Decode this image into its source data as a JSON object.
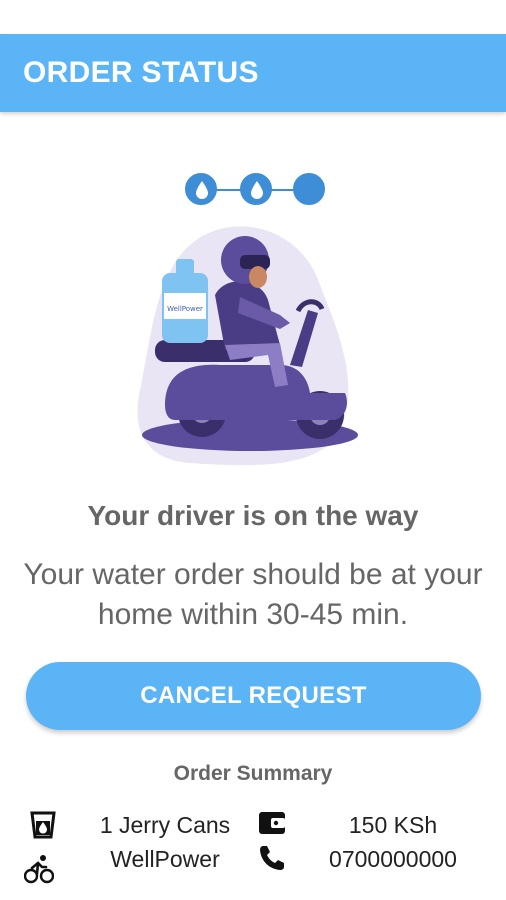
{
  "header": {
    "title": "ORDER STATUS"
  },
  "stepper": {
    "steps": [
      "drop-icon",
      "drop-icon",
      "circle"
    ]
  },
  "status": {
    "headline": "Your driver is on the way",
    "description": "Your water order should be at your home within 30-45 min."
  },
  "actions": {
    "cancel_label": "CANCEL REQUEST"
  },
  "summary": {
    "title": "Order Summary",
    "product": "1 Jerry Cans",
    "price": "150 KSh",
    "supplier": "WellPower",
    "phone": "0700000000"
  },
  "illustration": {
    "bottle_label": "WellPower"
  },
  "colors": {
    "accent": "#5ab4f5",
    "step": "#3d8ed6",
    "text_muted": "#666666",
    "illustration": "#5b4c9c"
  }
}
